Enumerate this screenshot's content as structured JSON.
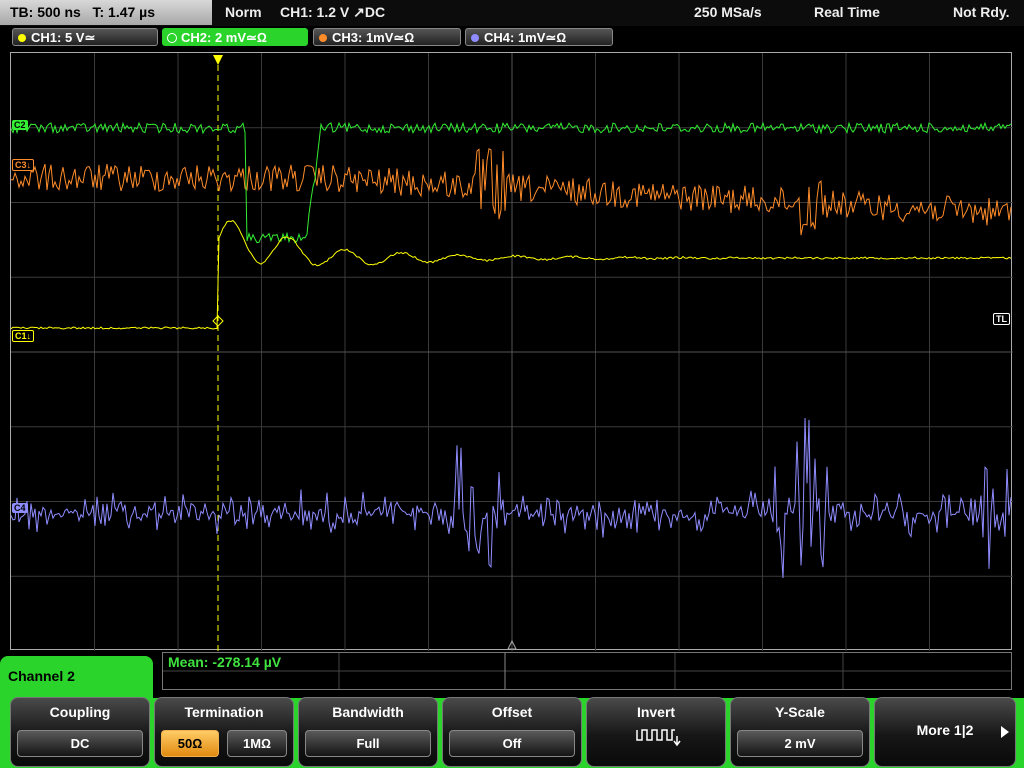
{
  "topbar": {
    "timebase": "TB: 500 ns",
    "trigger_time": "T: 1.47 µs",
    "trigger_mode": "Norm",
    "trigger_info": "CH1: 1.2 V ↗DC",
    "sample_rate": "250 MSa/s",
    "acq_mode": "Real Time",
    "status": "Not Rdy."
  },
  "channels": [
    {
      "label": "CH1: 5 V≃",
      "color": "#ffff00"
    },
    {
      "label": "CH2: 2 mV≃Ω",
      "color": "#33ee33"
    },
    {
      "label": "CH3: 1mV≃Ω",
      "color": "#ff8c2a"
    },
    {
      "label": "CH4: 1mV≃Ω",
      "color": "#8f8cff"
    }
  ],
  "markers": {
    "c2": "C2",
    "c3": "C3↓",
    "c1": "C1↓",
    "c4": "C4",
    "tl": "TL"
  },
  "measurement": "Mean: -278.14 µV",
  "menu": {
    "title": "Channel 2",
    "coupling": {
      "title": "Coupling",
      "value": "DC"
    },
    "termination": {
      "title": "Termination",
      "opt1": "50Ω",
      "opt2": "1MΩ"
    },
    "bandwidth": {
      "title": "Bandwidth",
      "value": "Full"
    },
    "offset": {
      "title": "Offset",
      "value": "Off"
    },
    "invert": {
      "title": "Invert"
    },
    "yscale": {
      "title": "Y-Scale",
      "value": "2 mV"
    },
    "more": {
      "label": "More 1|2"
    }
  }
}
